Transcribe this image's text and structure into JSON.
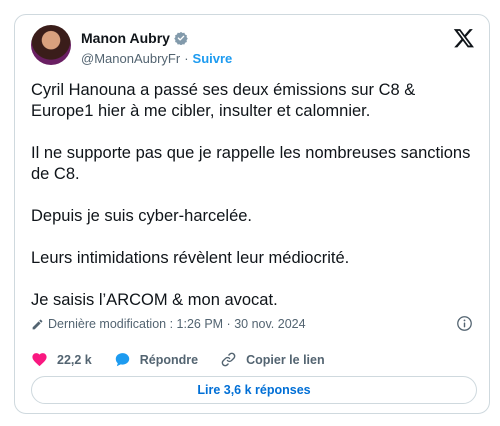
{
  "author": {
    "name": "Manon Aubry",
    "handle": "@ManonAubryFr",
    "separator": "·",
    "follow_label": "Suivre"
  },
  "tweet": {
    "paragraphs": [
      "Cyril Hanouna a passé ses deux émissions sur C8 & Europe1 hier à me cibler, insulter et calomnier.",
      "Il ne supporte pas que je rappelle les nombreuses sanctions de C8.",
      "Depuis je suis cyber-harcelée.",
      "Leurs intimidations révèlent leur médiocrité.",
      "Je saisis l’ARCOM & mon avocat."
    ],
    "edited_label": "Dernière modification : 1:26 PM · 30 nov. 2024"
  },
  "actions": {
    "likes": "22,2 k",
    "reply_label": "Répondre",
    "copy_link_label": "Copier le lien"
  },
  "read_replies_label": "Lire 3,6 k réponses",
  "colors": {
    "like": "#f91880",
    "reply": "#1d9bf0",
    "link": "#006fd6",
    "verified": "#829aab"
  }
}
